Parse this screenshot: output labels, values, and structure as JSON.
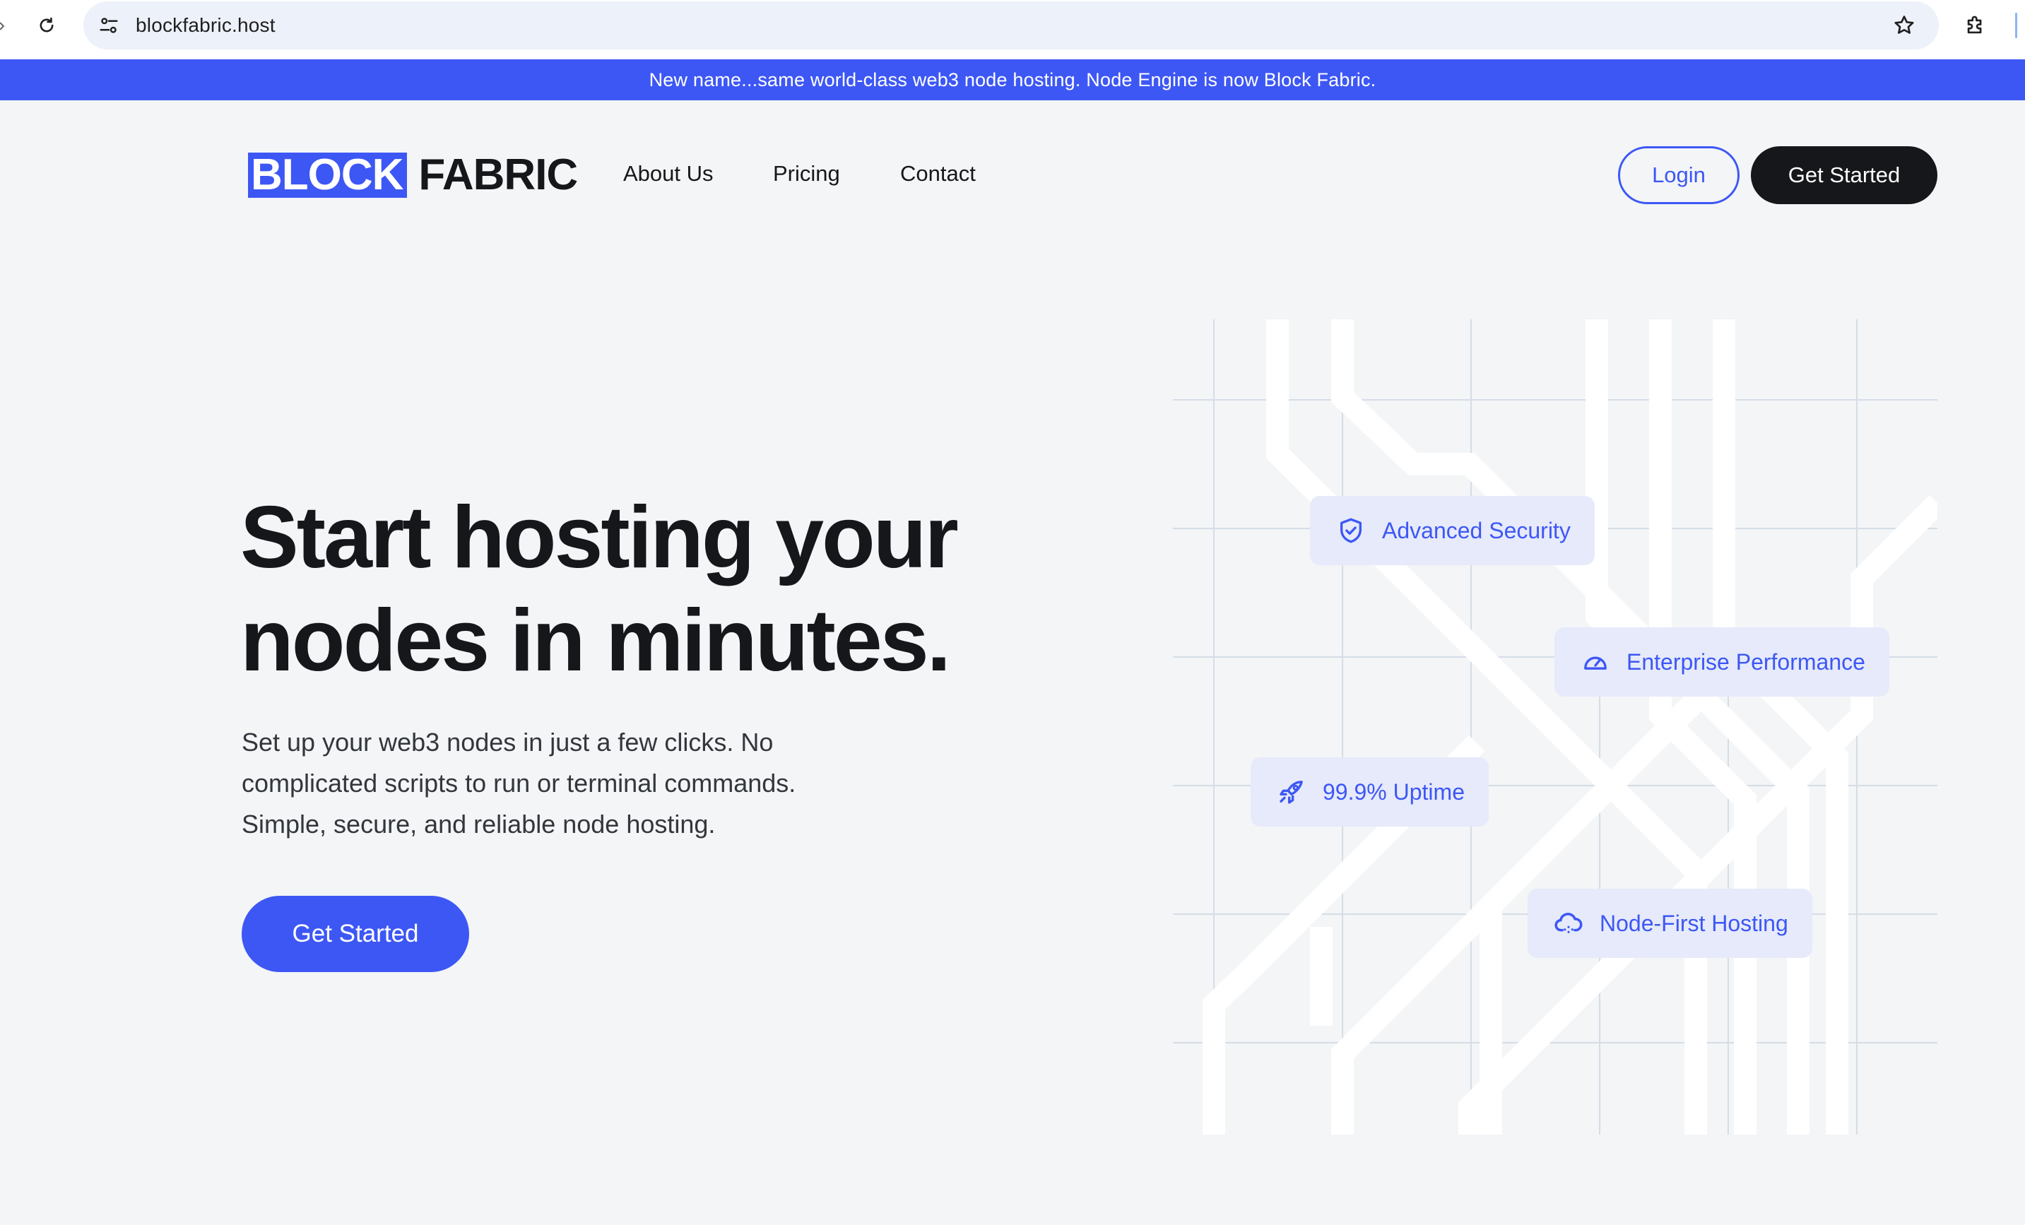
{
  "browser": {
    "url": "blockfabric.host"
  },
  "banner": {
    "text": "New name...same world-class web3 node hosting. Node Engine is now Block Fabric."
  },
  "nav": {
    "logo_part1": "BLOCK",
    "logo_part2": "FABRIC",
    "links": [
      "About Us",
      "Pricing",
      "Contact"
    ],
    "login_label": "Login",
    "get_started_label": "Get Started"
  },
  "hero": {
    "title_line1": "Start hosting your",
    "title_line2": "nodes in minutes.",
    "subtitle_line1": "Set up your web3 nodes in just a few clicks. No",
    "subtitle_line2": "complicated scripts to run or terminal commands.",
    "subtitle_line3": "Simple, secure, and reliable node hosting.",
    "cta_label": "Get Started"
  },
  "features": [
    {
      "label": "Advanced Security",
      "icon": "shield-check-icon"
    },
    {
      "label": "Enterprise Performance",
      "icon": "speedometer-icon"
    },
    {
      "label": "99.9% Uptime",
      "icon": "rocket-icon"
    },
    {
      "label": "Node-First Hosting",
      "icon": "cloud-icon"
    }
  ],
  "colors": {
    "accent": "#3d57f5",
    "dark": "#15171a",
    "background": "#f3f5f7",
    "feature_bg": "#e6eafa"
  }
}
